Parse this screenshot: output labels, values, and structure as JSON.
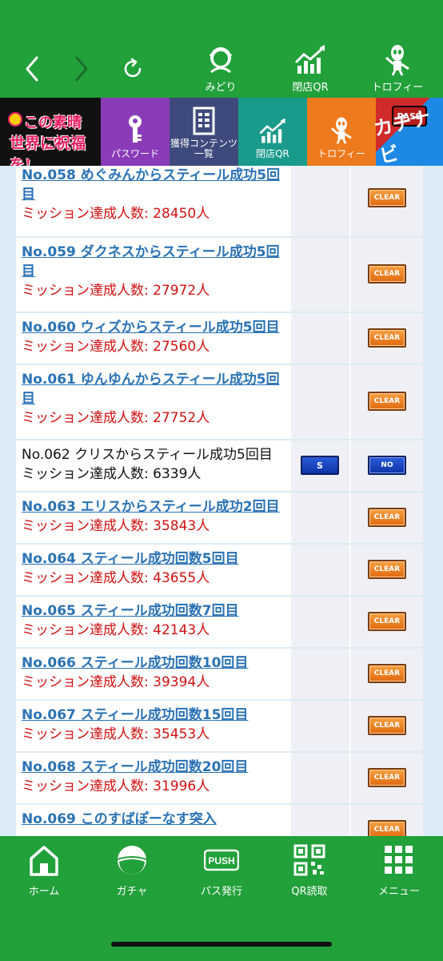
{
  "toolbar": {
    "items": [
      {
        "label": "みどり",
        "icon": "character-icon"
      },
      {
        "label": "閉店QR",
        "icon": "chart-up-icon"
      },
      {
        "label": "トロフィー",
        "icon": "alien-icon"
      }
    ]
  },
  "categories": [
    {
      "label": "",
      "icon": "konosuba-logo"
    },
    {
      "label": "パスワード",
      "icon": "key-icon"
    },
    {
      "label": "獲得コンテンツ\n一覧",
      "icon": "list-icon"
    },
    {
      "label": "閉店QR",
      "icon": "chart-up-icon"
    },
    {
      "label": "トロフィー",
      "icon": "alien-icon"
    },
    {
      "label": "",
      "icon": "kachinavi-logo"
    }
  ],
  "logo": {
    "line1": "この素晴らしい",
    "line2": "世界に祝福を!",
    "pass": "PASS",
    "kachinavi": "カチナビ"
  },
  "missions": [
    {
      "title": "No.058 めぐみんからスティール成功5回目",
      "count": "ミッション達成人数: 28450人",
      "status": "CLEAR",
      "s": ""
    },
    {
      "title": "No.059 ダクネスからスティール成功5回目",
      "count": "ミッション達成人数: 27972人",
      "status": "CLEAR",
      "s": ""
    },
    {
      "title": "No.060 ウィズからスティール成功5回目",
      "count": "ミッション達成人数: 27560人",
      "status": "CLEAR",
      "s": ""
    },
    {
      "title": "No.061 ゆんゆんからスティール成功5回目",
      "count": "ミッション達成人数: 27752人",
      "status": "CLEAR",
      "s": ""
    },
    {
      "title": "No.062 クリスからスティール成功5回目",
      "count": "ミッション達成人数: 6339人",
      "status": "NO",
      "s": "S"
    },
    {
      "title": "No.063 エリスからスティール成功2回目",
      "count": "ミッション達成人数: 35843人",
      "status": "CLEAR",
      "s": ""
    },
    {
      "title": "No.064 スティール成功回数5回目",
      "count": "ミッション達成人数: 43655人",
      "status": "CLEAR",
      "s": ""
    },
    {
      "title": "No.065 スティール成功回数7回目",
      "count": "ミッション達成人数: 42143人",
      "status": "CLEAR",
      "s": ""
    },
    {
      "title": "No.066 スティール成功回数10回目",
      "count": "ミッション達成人数: 39394人",
      "status": "CLEAR",
      "s": ""
    },
    {
      "title": "No.067 スティール成功回数15回目",
      "count": "ミッション達成人数: 35453人",
      "status": "CLEAR",
      "s": ""
    },
    {
      "title": "No.068 スティール成功回数20回目",
      "count": "ミッション達成人数: 31996人",
      "status": "CLEAR",
      "s": ""
    },
    {
      "title": "No.069 このすばぽーなす突入",
      "count": "",
      "status": "CLEAR",
      "s": ""
    }
  ],
  "bottom": {
    "items": [
      {
        "label": "ホーム",
        "icon": "home-icon"
      },
      {
        "label": "ガチャ",
        "icon": "gacha-icon"
      },
      {
        "label": "パス発行",
        "icon": "push-icon"
      },
      {
        "label": "QR読取",
        "icon": "qr-icon"
      },
      {
        "label": "メニュー",
        "icon": "menu-grid-icon"
      }
    ],
    "push_text": "PUSH"
  }
}
